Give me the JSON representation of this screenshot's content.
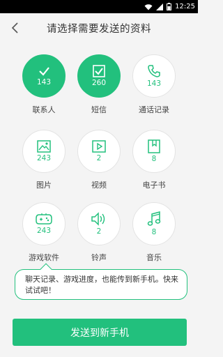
{
  "status_bar": {
    "time": "12:25"
  },
  "header": {
    "title": "请选择需要发送的资料"
  },
  "items": [
    {
      "label": "联系人",
      "count": "143",
      "icon": "checkmark-icon",
      "selected": true
    },
    {
      "label": "短信",
      "count": "260",
      "icon": "checkbox-icon",
      "selected": true
    },
    {
      "label": "通话记录",
      "count": "143",
      "icon": "phone-icon",
      "selected": false
    },
    {
      "label": "图片",
      "count": "243",
      "icon": "image-icon",
      "selected": false
    },
    {
      "label": "视频",
      "count": "2",
      "icon": "video-play-icon",
      "selected": false
    },
    {
      "label": "电子书",
      "count": "8",
      "icon": "ebook-icon",
      "selected": false
    },
    {
      "label": "游戏软件",
      "count": "243",
      "icon": "gamepad-icon",
      "selected": false
    },
    {
      "label": "铃声",
      "count": "2",
      "icon": "speaker-icon",
      "selected": false
    },
    {
      "label": "音乐",
      "count": "8",
      "icon": "music-note-icon",
      "selected": false
    }
  ],
  "tooltip": {
    "text": "聊天记录、游戏进度，也能传到新手机。快来试试吧！"
  },
  "send_button": {
    "label": "发送到新手机"
  },
  "colors": {
    "accent": "#22c07d",
    "background": "#f4f4f4"
  }
}
